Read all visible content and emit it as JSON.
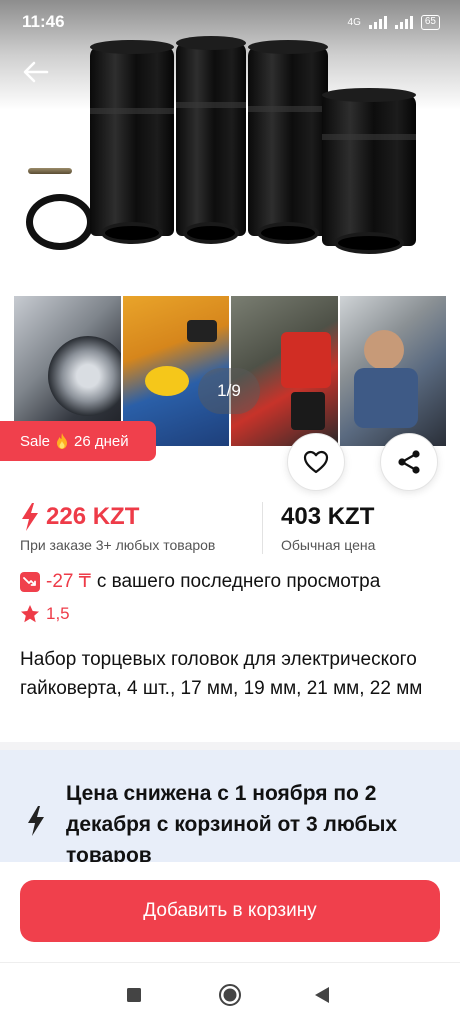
{
  "status_bar": {
    "time": "11:46",
    "network_label": "4G",
    "battery": "65"
  },
  "gallery": {
    "counter": "1/9",
    "thumbnails_count": 4
  },
  "sale_badge": {
    "label": "Sale",
    "days": "26 дней"
  },
  "price": {
    "bulk_price": "226 KZT",
    "bulk_note": "При заказе 3+ любых товаров",
    "regular_price": "403 KZT",
    "regular_note": "Обычная цена"
  },
  "price_drop": {
    "value": "-27 ₸",
    "text": "с вашего последнего просмотра"
  },
  "rating": {
    "value": "1,5"
  },
  "product": {
    "title": "Набор торцевых головок для электрического гайковерта, 4 шт., 17 мм, 19 мм, 21 мм, 22 мм"
  },
  "promo": {
    "text": "Цена снижена с 1 ноября по 2 декабря с корзиной от 3 любых товаров"
  },
  "actions": {
    "add_to_cart": "Добавить в корзину"
  },
  "icons": {
    "back": "arrow-left-icon",
    "favorite": "heart-icon",
    "share": "share-icon",
    "lightning": "lightning-icon",
    "star": "star-icon",
    "price_down": "trend-down-icon"
  },
  "colors": {
    "accent": "#f0404c",
    "promo_bg": "#e8eef9"
  }
}
